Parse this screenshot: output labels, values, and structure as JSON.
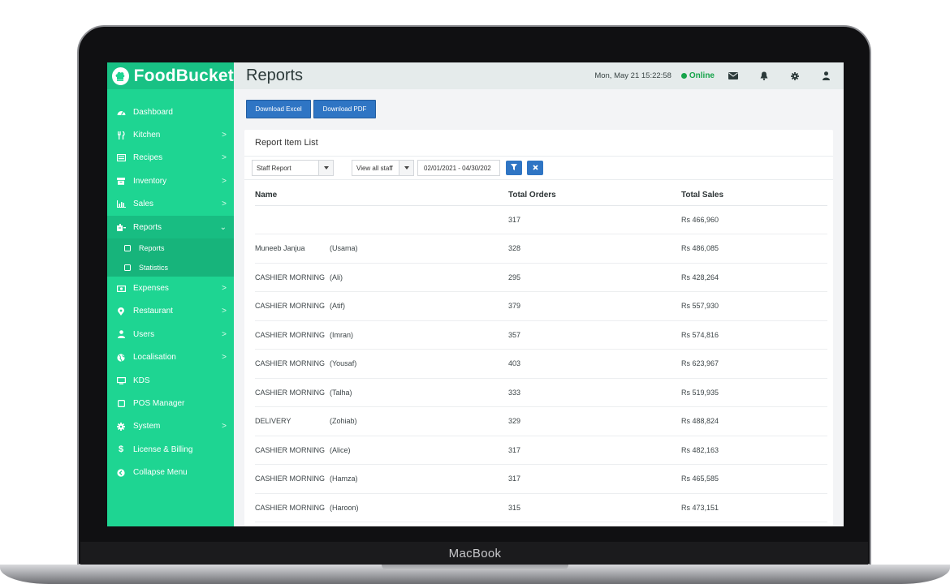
{
  "device": {
    "label": "MacBook"
  },
  "app": {
    "name": "FoodBucket"
  },
  "sidebar": {
    "items": [
      {
        "label": "Dashboard",
        "icon": "dashboard-icon",
        "chevron": false
      },
      {
        "label": "Kitchen",
        "icon": "kitchen-icon",
        "chevron": true
      },
      {
        "label": "Recipes",
        "icon": "recipes-icon",
        "chevron": true
      },
      {
        "label": "Inventory",
        "icon": "inventory-icon",
        "chevron": true
      },
      {
        "label": "Sales",
        "icon": "sales-chart-icon",
        "chevron": true
      },
      {
        "label": "Reports",
        "icon": "reports-icon",
        "chevron": true,
        "expanded": true
      },
      {
        "label": "Expenses",
        "icon": "expenses-icon",
        "chevron": true
      },
      {
        "label": "Restaurant",
        "icon": "location-pin-icon",
        "chevron": true
      },
      {
        "label": "Users",
        "icon": "user-icon",
        "chevron": true
      },
      {
        "label": "Localisation",
        "icon": "globe-icon",
        "chevron": true
      },
      {
        "label": "KDS",
        "icon": "monitor-icon",
        "chevron": false
      },
      {
        "label": "POS Manager",
        "icon": "square-icon",
        "chevron": false
      },
      {
        "label": "System",
        "icon": "gear-icon",
        "chevron": true
      },
      {
        "label": "License & Billing",
        "icon": "dollar-icon",
        "chevron": false
      },
      {
        "label": "Collapse Menu",
        "icon": "collapse-icon",
        "chevron": false
      }
    ],
    "submenu": [
      {
        "label": "Reports"
      },
      {
        "label": "Statistics"
      }
    ],
    "chevron_glyph": ">",
    "expanded_glyph": "⌄"
  },
  "header": {
    "title": "Reports",
    "datetime": "Mon, May 21 15:22:58",
    "status": "Online"
  },
  "toolbar": {
    "excel_label": "Download Excel",
    "pdf_label": "Download PDF"
  },
  "card": {
    "title": "Report Item List",
    "report_type": "Staff Report",
    "staff_filter": "View all staff",
    "date_range": "02/01/2021 - 04/30/202"
  },
  "table": {
    "headers": [
      "Name",
      "Total Orders",
      "Total Sales"
    ],
    "rows": [
      {
        "name": "",
        "staff": "",
        "orders": "317",
        "sales": "Rs 466,960"
      },
      {
        "name": "Muneeb Janjua",
        "staff": "(Usama)",
        "orders": "328",
        "sales": "Rs 486,085"
      },
      {
        "name": "CASHIER MORNING",
        "staff": "(Ali)",
        "orders": "295",
        "sales": "Rs 428,264"
      },
      {
        "name": "CASHIER MORNING",
        "staff": "(Atif)",
        "orders": "379",
        "sales": "Rs 557,930"
      },
      {
        "name": "CASHIER MORNING",
        "staff": "(Imran)",
        "orders": "357",
        "sales": "Rs 574,816"
      },
      {
        "name": "CASHIER MORNING",
        "staff": "(Yousaf)",
        "orders": "403",
        "sales": "Rs 623,967"
      },
      {
        "name": "CASHIER MORNING",
        "staff": "(Talha)",
        "orders": "333",
        "sales": "Rs 519,935"
      },
      {
        "name": "DELIVERY",
        "staff": "(Zohiab)",
        "orders": "329",
        "sales": "Rs 488,824"
      },
      {
        "name": "CASHIER MORNING",
        "staff": "(Alice)",
        "orders": "317",
        "sales": "Rs 482,163"
      },
      {
        "name": "CASHIER MORNING",
        "staff": "(Hamza)",
        "orders": "317",
        "sales": "Rs 465,585"
      },
      {
        "name": "CASHIER MORNING",
        "staff": "(Haroon)",
        "orders": "315",
        "sales": "Rs 473,151"
      }
    ]
  },
  "colors": {
    "sidebar": "#1ed592",
    "sidebar_active": "#18bd82",
    "primary_button": "#2f75c4",
    "online": "#16a34a",
    "topbar": "#e5ebeb"
  }
}
